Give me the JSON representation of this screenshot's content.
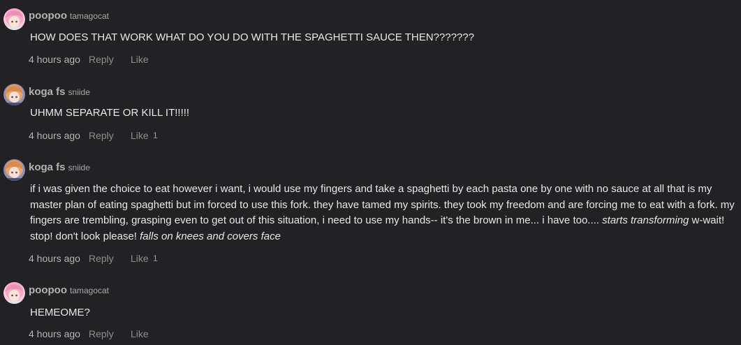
{
  "colors": {
    "background": "#222224",
    "text": "#e8e8e8",
    "muted": "#8e8e8e",
    "avatar_pink": "#f3a9c8",
    "avatar_orange": "#e8a56a"
  },
  "comments": [
    {
      "display_name": "poopoo",
      "username": "tamagocat",
      "avatar_icon": "pink-hair-avatar",
      "body_parts": [
        "HOW DOES THAT WORK WHAT DO YOU DO WITH THE SPAGHETTI SAUCE THEN???????"
      ],
      "timestamp": "4 hours ago",
      "reply_label": "Reply",
      "like_label": "Like",
      "like_count": ""
    },
    {
      "display_name": "koga fs",
      "username": "sniide",
      "avatar_icon": "orange-hair-avatar",
      "body_parts": [
        "UHMM SEPARATE OR KILL IT!!!!!"
      ],
      "timestamp": "4 hours ago",
      "reply_label": "Reply",
      "like_label": "Like",
      "like_count": "1"
    },
    {
      "display_name": "koga fs",
      "username": "sniide",
      "avatar_icon": "orange-hair-avatar",
      "body_parts": [
        "if i was given the choice to eat however i want, i would use my fingers and take a spaghetti by each pasta one by one with no sauce at all that is my master plan of eating spaghetti but im forced to use this fork. they have tamed my spirits. they took my freedom and are forcing me to eat with a fork. my fingers are trembling, grasping even to get out of this situation, i need to use my hands-- it's the brown in me... i have too.... ",
        "starts transforming",
        " w-wait! stop! don't look please! ",
        "falls on knees and covers face"
      ],
      "timestamp": "4 hours ago",
      "reply_label": "Reply",
      "like_label": "Like",
      "like_count": "1"
    },
    {
      "display_name": "poopoo",
      "username": "tamagocat",
      "avatar_icon": "pink-hair-avatar",
      "body_parts": [
        "HEMEOME?"
      ],
      "timestamp": "4 hours ago",
      "reply_label": "Reply",
      "like_label": "Like",
      "like_count": ""
    }
  ]
}
